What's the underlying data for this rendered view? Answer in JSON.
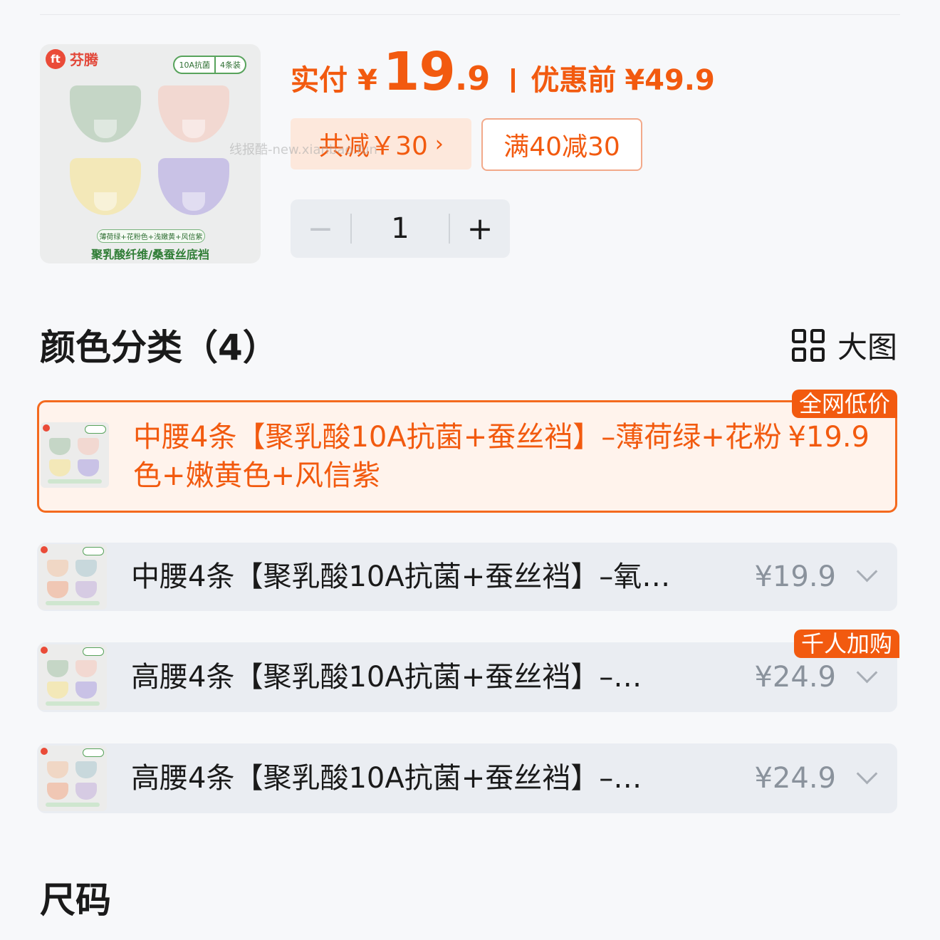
{
  "product": {
    "brand": "芬腾",
    "badges": [
      "10A抗菌",
      "4条装"
    ],
    "caption": "薄荷绿+花粉色+浅嫩黄+风信紫",
    "material": "聚乳酸纤维/桑蚕丝底裆"
  },
  "price": {
    "label": "实付",
    "currency": "¥",
    "integer": "19",
    "decimal": ".9",
    "original_label": "优惠前",
    "original_value": "¥49.9"
  },
  "coupons": {
    "total_discount": "共减￥30",
    "rule": "满40减30"
  },
  "watermark": "线报酷-new.xianbao.fun",
  "quantity": {
    "minus": "−",
    "value": "1",
    "plus": "+"
  },
  "section": {
    "title": "颜色分类（4）",
    "view_toggle": "大图"
  },
  "options": [
    {
      "label": "中腰4条【聚乳酸10A抗菌+蚕丝裆】–薄荷绿+花粉色+嫩黄色+风信紫",
      "price": "¥19.9",
      "badge": "全网低价",
      "selected": true
    },
    {
      "label": "中腰4条【聚乳酸10A抗菌+蚕丝裆】–氧…",
      "price": "¥19.9",
      "badge": "",
      "selected": false
    },
    {
      "label": "高腰4条【聚乳酸10A抗菌+蚕丝裆】–…",
      "price": "¥24.9",
      "badge": "千人加购",
      "selected": false
    },
    {
      "label": "高腰4条【聚乳酸10A抗菌+蚕丝裆】–…",
      "price": "¥24.9",
      "badge": "",
      "selected": false
    }
  ],
  "size_section": {
    "title": "尺码"
  },
  "colors": {
    "accent": "#f25a0f",
    "selected_border": "#f46a1e",
    "selected_bg": "#fff3ec",
    "option_bg": "#eaedf2"
  }
}
